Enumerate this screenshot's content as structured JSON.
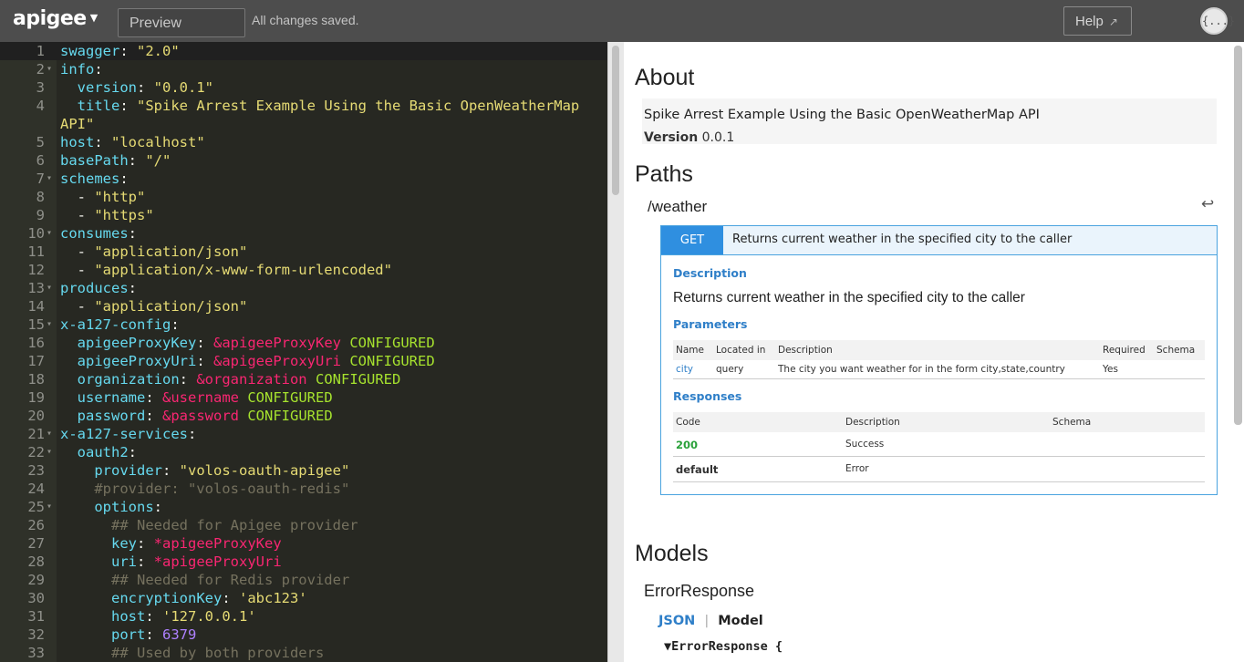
{
  "topbar": {
    "logo": "apigee",
    "preview_label": "Preview",
    "status": "All changes saved.",
    "help_label": "Help",
    "help_arrow": "↗",
    "avatar_glyph": "{...}"
  },
  "editor": {
    "lines": [
      {
        "n": "1",
        "fold": "",
        "active": true,
        "parts": [
          [
            "k",
            "swagger"
          ],
          [
            "p",
            ": "
          ],
          [
            "s",
            "\"2.0\""
          ]
        ]
      },
      {
        "n": "2",
        "fold": "▾",
        "parts": [
          [
            "k",
            "info"
          ],
          [
            "p",
            ":"
          ]
        ]
      },
      {
        "n": "3",
        "fold": "",
        "parts": [
          [
            "p",
            "  "
          ],
          [
            "k",
            "version"
          ],
          [
            "p",
            ": "
          ],
          [
            "s",
            "\"0.0.1\""
          ]
        ]
      },
      {
        "n": "4",
        "fold": "",
        "parts": [
          [
            "p",
            "  "
          ],
          [
            "k",
            "title"
          ],
          [
            "p",
            ": "
          ],
          [
            "s",
            "\"Spike Arrest Example Using the Basic OpenWeatherMap"
          ]
        ]
      },
      {
        "n": "",
        "fold": "",
        "parts": [
          [
            "s",
            "API\""
          ]
        ]
      },
      {
        "n": "5",
        "fold": "",
        "parts": [
          [
            "k",
            "host"
          ],
          [
            "p",
            ": "
          ],
          [
            "s",
            "\"localhost\""
          ]
        ]
      },
      {
        "n": "6",
        "fold": "",
        "parts": [
          [
            "k",
            "basePath"
          ],
          [
            "p",
            ": "
          ],
          [
            "s",
            "\"/\""
          ]
        ]
      },
      {
        "n": "7",
        "fold": "▾",
        "parts": [
          [
            "k",
            "schemes"
          ],
          [
            "p",
            ":"
          ]
        ]
      },
      {
        "n": "8",
        "fold": "",
        "parts": [
          [
            "p",
            "  - "
          ],
          [
            "s",
            "\"http\""
          ]
        ]
      },
      {
        "n": "9",
        "fold": "",
        "parts": [
          [
            "p",
            "  - "
          ],
          [
            "s",
            "\"https\""
          ]
        ]
      },
      {
        "n": "10",
        "fold": "▾",
        "parts": [
          [
            "k",
            "consumes"
          ],
          [
            "p",
            ":"
          ]
        ]
      },
      {
        "n": "11",
        "fold": "",
        "parts": [
          [
            "p",
            "  - "
          ],
          [
            "s",
            "\"application/json\""
          ]
        ]
      },
      {
        "n": "12",
        "fold": "",
        "parts": [
          [
            "p",
            "  - "
          ],
          [
            "s",
            "\"application/x-www-form-urlencoded\""
          ]
        ]
      },
      {
        "n": "13",
        "fold": "▾",
        "parts": [
          [
            "k",
            "produces"
          ],
          [
            "p",
            ":"
          ]
        ]
      },
      {
        "n": "14",
        "fold": "",
        "parts": [
          [
            "p",
            "  - "
          ],
          [
            "s",
            "\"application/json\""
          ]
        ]
      },
      {
        "n": "15",
        "fold": "▾",
        "parts": [
          [
            "k",
            "x-a127-config"
          ],
          [
            "p",
            ":"
          ]
        ]
      },
      {
        "n": "16",
        "fold": "",
        "parts": [
          [
            "p",
            "  "
          ],
          [
            "k",
            "apigeeProxyKey"
          ],
          [
            "p",
            ": "
          ],
          [
            "a",
            "&apigeeProxyKey"
          ],
          [
            "p",
            " "
          ],
          [
            "g",
            "CONFIGURED"
          ]
        ]
      },
      {
        "n": "17",
        "fold": "",
        "parts": [
          [
            "p",
            "  "
          ],
          [
            "k",
            "apigeeProxyUri"
          ],
          [
            "p",
            ": "
          ],
          [
            "a",
            "&apigeeProxyUri"
          ],
          [
            "p",
            " "
          ],
          [
            "g",
            "CONFIGURED"
          ]
        ]
      },
      {
        "n": "18",
        "fold": "",
        "parts": [
          [
            "p",
            "  "
          ],
          [
            "k",
            "organization"
          ],
          [
            "p",
            ": "
          ],
          [
            "a",
            "&organization"
          ],
          [
            "p",
            " "
          ],
          [
            "g",
            "CONFIGURED"
          ]
        ]
      },
      {
        "n": "19",
        "fold": "",
        "parts": [
          [
            "p",
            "  "
          ],
          [
            "k",
            "username"
          ],
          [
            "p",
            ": "
          ],
          [
            "a",
            "&username"
          ],
          [
            "p",
            " "
          ],
          [
            "g",
            "CONFIGURED"
          ]
        ]
      },
      {
        "n": "20",
        "fold": "",
        "parts": [
          [
            "p",
            "  "
          ],
          [
            "k",
            "password"
          ],
          [
            "p",
            ": "
          ],
          [
            "a",
            "&password"
          ],
          [
            "p",
            " "
          ],
          [
            "g",
            "CONFIGURED"
          ]
        ]
      },
      {
        "n": "21",
        "fold": "▾",
        "parts": [
          [
            "k",
            "x-a127-services"
          ],
          [
            "p",
            ":"
          ]
        ]
      },
      {
        "n": "22",
        "fold": "▾",
        "parts": [
          [
            "p",
            "  "
          ],
          [
            "k",
            "oauth2"
          ],
          [
            "p",
            ":"
          ]
        ]
      },
      {
        "n": "23",
        "fold": "",
        "parts": [
          [
            "p",
            "    "
          ],
          [
            "k",
            "provider"
          ],
          [
            "p",
            ": "
          ],
          [
            "s",
            "\"volos-oauth-apigee\""
          ]
        ]
      },
      {
        "n": "24",
        "fold": "",
        "parts": [
          [
            "p",
            "    "
          ],
          [
            "c",
            "#provider: \"volos-oauth-redis\""
          ]
        ]
      },
      {
        "n": "25",
        "fold": "▾",
        "parts": [
          [
            "p",
            "    "
          ],
          [
            "k",
            "options"
          ],
          [
            "p",
            ":"
          ]
        ]
      },
      {
        "n": "26",
        "fold": "",
        "parts": [
          [
            "p",
            "      "
          ],
          [
            "c",
            "## Needed for Apigee provider"
          ]
        ]
      },
      {
        "n": "27",
        "fold": "",
        "parts": [
          [
            "p",
            "      "
          ],
          [
            "k",
            "key"
          ],
          [
            "p",
            ": "
          ],
          [
            "a",
            "*apigeeProxyKey"
          ]
        ]
      },
      {
        "n": "28",
        "fold": "",
        "parts": [
          [
            "p",
            "      "
          ],
          [
            "k",
            "uri"
          ],
          [
            "p",
            ": "
          ],
          [
            "a",
            "*apigeeProxyUri"
          ]
        ]
      },
      {
        "n": "29",
        "fold": "",
        "parts": [
          [
            "p",
            "      "
          ],
          [
            "c",
            "## Needed for Redis provider"
          ]
        ]
      },
      {
        "n": "30",
        "fold": "",
        "parts": [
          [
            "p",
            "      "
          ],
          [
            "k",
            "encryptionKey"
          ],
          [
            "p",
            ": "
          ],
          [
            "s",
            "'abc123'"
          ]
        ]
      },
      {
        "n": "31",
        "fold": "",
        "parts": [
          [
            "p",
            "      "
          ],
          [
            "k",
            "host"
          ],
          [
            "p",
            ": "
          ],
          [
            "s",
            "'127.0.0.1'"
          ]
        ]
      },
      {
        "n": "32",
        "fold": "",
        "parts": [
          [
            "p",
            "      "
          ],
          [
            "k",
            "port"
          ],
          [
            "p",
            ": "
          ],
          [
            "n",
            "6379"
          ]
        ]
      },
      {
        "n": "33",
        "fold": "",
        "parts": [
          [
            "p",
            "      "
          ],
          [
            "c",
            "## Used by both providers"
          ]
        ]
      }
    ]
  },
  "preview": {
    "about_heading": "About",
    "api_title": "Spike Arrest Example Using the Basic OpenWeatherMap API",
    "version_label": "Version",
    "version_value": "0.0.1",
    "paths_heading": "Paths",
    "path": "/weather",
    "back_icon": "↩",
    "operation": {
      "method": "GET",
      "summary": "Returns current weather in the specified city to the caller",
      "description_label": "Description",
      "description": "Returns current weather in the specified city to the caller",
      "parameters_label": "Parameters",
      "param_headers": [
        "Name",
        "Located in",
        "Description",
        "Required",
        "Schema"
      ],
      "params": [
        {
          "name": "city",
          "in": "query",
          "description": "The city you want weather for in the form city,state,country",
          "required": "Yes",
          "schema": ""
        }
      ],
      "responses_label": "Responses",
      "response_headers": [
        "Code",
        "Description",
        "Schema"
      ],
      "responses": [
        {
          "code": "200",
          "description": "Success"
        },
        {
          "code": "default",
          "description": "Error"
        }
      ]
    },
    "models_heading": "Models",
    "model_name": "ErrorResponse",
    "tab_json": "JSON",
    "tab_sep": "|",
    "tab_model": "Model",
    "model_line": "▼ErrorResponse {"
  }
}
